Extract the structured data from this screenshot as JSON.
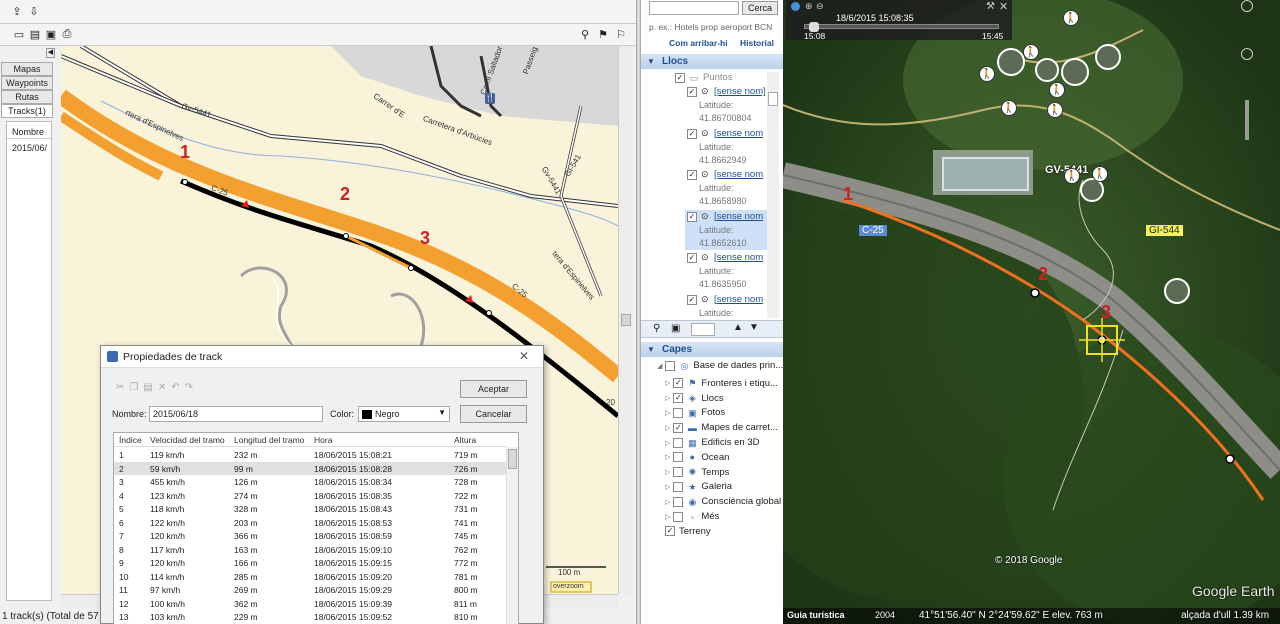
{
  "left_app": {
    "nav_tabs": [
      "Mapas",
      "Waypoints",
      "Rutas",
      "Tracks(1)"
    ],
    "tracks_list": {
      "header": "Nombre",
      "items": [
        "2015/06/"
      ]
    },
    "status_text": "1 track(s) (Total de 57",
    "map": {
      "road_labels": [
        "Gv-5441",
        "Carrer d'E",
        "Carretera d'Arbúcies",
        "Camí Saltador",
        "Passeig",
        "Gv-5441",
        "C-25",
        "C-25",
        "rtera d'Espinelves",
        "tera d'Espinelves",
        "Gi-541"
      ],
      "point_numbers": [
        "1",
        "2",
        "3"
      ],
      "scale_label": "100 m",
      "overzoom_label": "overzoom",
      "edge_label": "20"
    }
  },
  "dialog": {
    "title": "Propiedades de track",
    "close_glyph": "✕",
    "buttons": {
      "accept": "Aceptar",
      "cancel": "Cancelar"
    },
    "name_label": "Nombre:",
    "name_value": "2015/06/18",
    "color_label": "Color:",
    "color_value": "Negro",
    "columns": [
      "Índice",
      "Velocidad del tramo",
      "Longitud del tramo",
      "Hora",
      "Altura"
    ],
    "rows": [
      [
        "1",
        "119 km/h",
        "232 m",
        "18/06/2015 15:08:21",
        "719 m"
      ],
      [
        "2",
        "59 km/h",
        "99 m",
        "18/06/2015 15:08:28",
        "726 m"
      ],
      [
        "3",
        "455 km/h",
        "126 m",
        "18/06/2015 15:08:34",
        "728 m"
      ],
      [
        "4",
        "123 km/h",
        "274 m",
        "18/06/2015 15:08:35",
        "722 m"
      ],
      [
        "5",
        "118 km/h",
        "328 m",
        "18/06/2015 15:08:43",
        "731 m"
      ],
      [
        "6",
        "122 km/h",
        "203 m",
        "18/06/2015 15:08:53",
        "741 m"
      ],
      [
        "7",
        "120 km/h",
        "366 m",
        "18/06/2015 15:08:59",
        "745 m"
      ],
      [
        "8",
        "117 km/h",
        "163 m",
        "18/06/2015 15:09:10",
        "762 m"
      ],
      [
        "9",
        "120 km/h",
        "166 m",
        "18/06/2015 15:09:15",
        "772 m"
      ],
      [
        "10",
        "114 km/h",
        "285 m",
        "18/06/2015 15:09:20",
        "781 m"
      ],
      [
        "11",
        "97 km/h",
        "269 m",
        "18/06/2015 15:09:29",
        "800 m"
      ],
      [
        "12",
        "100 km/h",
        "362 m",
        "18/06/2015 15:09:39",
        "811 m"
      ],
      [
        "13",
        "103 km/h",
        "229 m",
        "18/06/2015 15:09:52",
        "810 m"
      ]
    ],
    "selected_row": 2
  },
  "middle_panel": {
    "search": {
      "value": "",
      "button": "Cerca",
      "hint": "p. ex.: Hotels prop aeroport BCN",
      "link1": "Com arribar-hi",
      "link2": "Historial"
    },
    "places_header": "Llocs",
    "places_folder": "Puntos",
    "place_items": [
      {
        "name": "[sense nom]",
        "lat_label": "Latitude:",
        "lat": "41.86700804"
      },
      {
        "name": "[sense nom",
        "lat_label": "Latitude:",
        "lat": "41.8662949"
      },
      {
        "name": "[sense nom",
        "lat_label": "Latitude:",
        "lat": "41.8658980"
      },
      {
        "name": "[sense nom",
        "lat_label": "Latitude:",
        "lat": "41.8652610"
      },
      {
        "name": "[sense nom",
        "lat_label": "Latitude:",
        "lat": "41.8635950"
      },
      {
        "name": "[sense nom",
        "lat_label": "Latitude:",
        "lat": ""
      }
    ],
    "layers_header": "Capes",
    "layers": [
      {
        "label": "Base de dades prin...",
        "checked": false,
        "icon": "globe-db-icon"
      },
      {
        "label": "Fronteres i etiqu...",
        "checked": true,
        "icon": "flag-icon"
      },
      {
        "label": "Llocs",
        "checked": true,
        "icon": "places-icon"
      },
      {
        "label": "Fotos",
        "checked": false,
        "icon": "photo-icon"
      },
      {
        "label": "Mapes de carret...",
        "checked": true,
        "icon": "road-icon"
      },
      {
        "label": "Edificis en 3D",
        "checked": false,
        "icon": "building-icon"
      },
      {
        "label": "Ocean",
        "checked": false,
        "icon": "ocean-icon"
      },
      {
        "label": "Temps",
        "checked": false,
        "icon": "weather-icon"
      },
      {
        "label": "Galeria",
        "checked": false,
        "icon": "star-icon"
      },
      {
        "label": "Consciència global",
        "checked": false,
        "icon": "globe-icon"
      },
      {
        "label": "Més",
        "checked": false,
        "icon": "more-icon"
      },
      {
        "label": "Terreny",
        "checked": true,
        "icon": "terrain-icon"
      }
    ]
  },
  "earth": {
    "timeline": {
      "datetime": "18/6/2015  15:08:35",
      "start": "15:08",
      "end": "15:45"
    },
    "road_labels": [
      "C-25",
      "GV-5441",
      "GI-544"
    ],
    "point_numbers": [
      "1",
      "2",
      "3"
    ],
    "copyright": "© 2018 Google",
    "brand": "Google Earth",
    "status": {
      "tour": "Guia turística",
      "year": "2004",
      "coords": "41°51'56.40\" N   2°24'59.62\" E  elev.   763 m",
      "eye_alt": "alçada d'ull   1.39 km"
    },
    "colors": {
      "track": "#f07020",
      "highlight": "#f0e020",
      "road": "#f4a020"
    }
  }
}
